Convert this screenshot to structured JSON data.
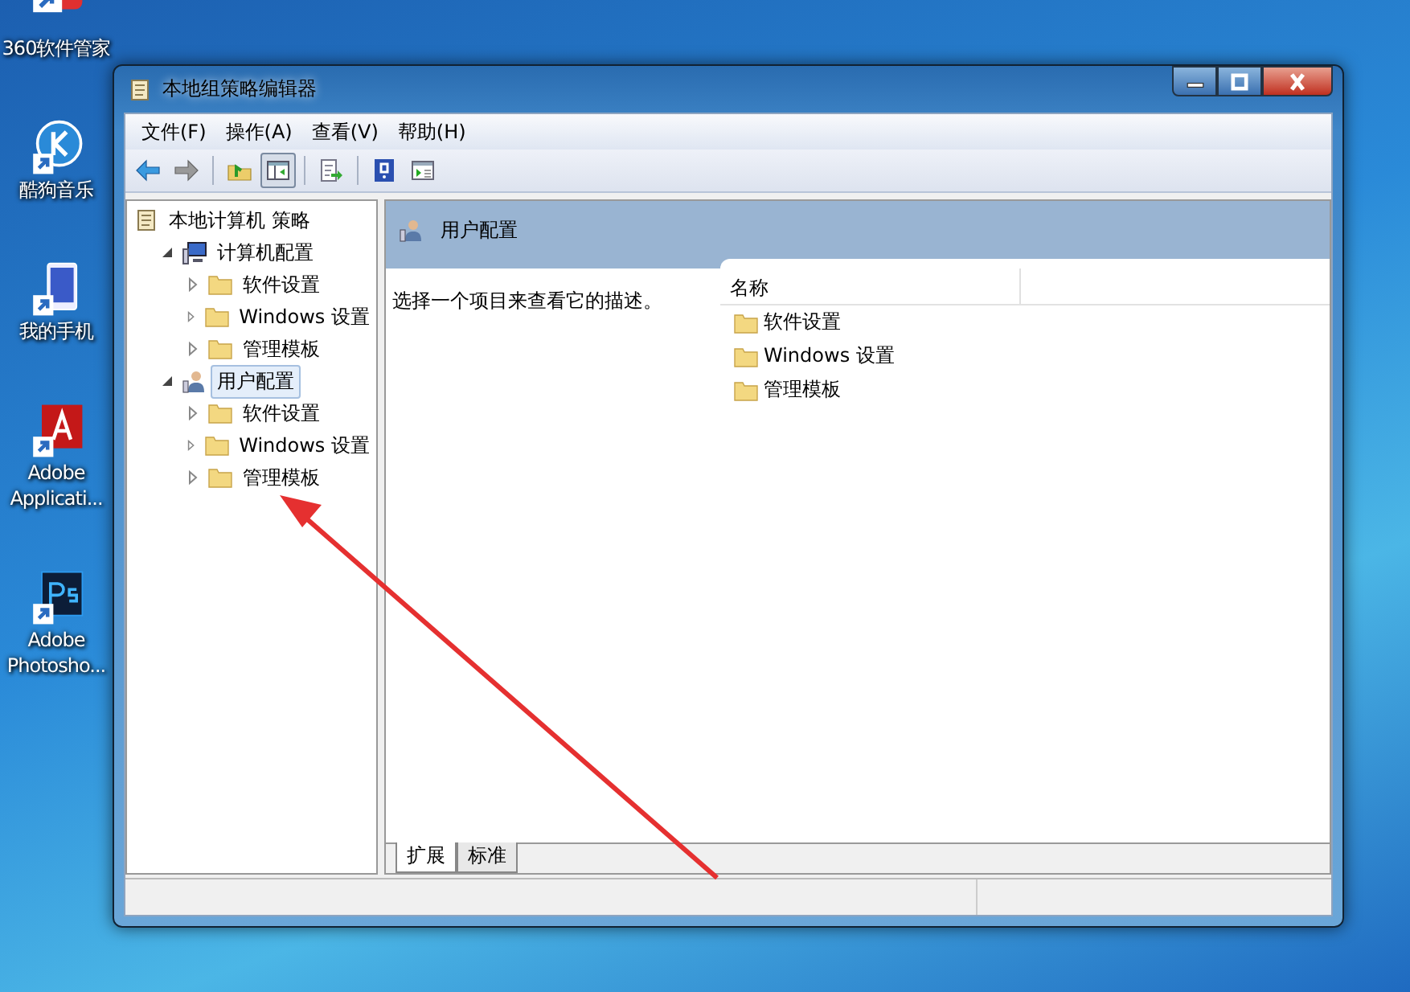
{
  "desktop_icons": [
    {
      "label": "360软件管家",
      "kind": "box"
    },
    {
      "label": "酷狗音乐",
      "kind": "k"
    },
    {
      "label": "我的手机",
      "kind": "phone"
    },
    {
      "label": "Adobe Applicati...",
      "kind": "adobe"
    },
    {
      "label": "Adobe Photosho...",
      "kind": "ps"
    }
  ],
  "window": {
    "title": "本地组策略编辑器"
  },
  "menu": [
    "文件(F)",
    "操作(A)",
    "查看(V)",
    "帮助(H)"
  ],
  "toolbar": [
    {
      "kind": "back"
    },
    {
      "kind": "forward"
    },
    {
      "kind": "sep"
    },
    {
      "kind": "up"
    },
    {
      "kind": "tree",
      "selected": true
    },
    {
      "kind": "sep"
    },
    {
      "kind": "export"
    },
    {
      "kind": "sep"
    },
    {
      "kind": "help"
    },
    {
      "kind": "console"
    }
  ],
  "tree": [
    {
      "label": "本地计算机 策略",
      "kind": "policy",
      "selected": false,
      "children": [
        {
          "label": "计算机配置",
          "kind": "computer",
          "expanded": true,
          "selected": false,
          "children": [
            {
              "label": "软件设置",
              "kind": "folder",
              "expanded": false,
              "selected": false
            },
            {
              "label": "Windows 设置",
              "kind": "folder",
              "expanded": false,
              "selected": false
            },
            {
              "label": "管理模板",
              "kind": "folder",
              "expanded": false,
              "selected": false
            }
          ]
        },
        {
          "label": "用户配置",
          "kind": "user",
          "expanded": true,
          "selected": true,
          "children": [
            {
              "label": "软件设置",
              "kind": "folder",
              "expanded": false,
              "selected": false
            },
            {
              "label": "Windows 设置",
              "kind": "folder",
              "expanded": false,
              "selected": false
            },
            {
              "label": "管理模板",
              "kind": "folder",
              "expanded": false,
              "selected": false
            }
          ]
        }
      ]
    }
  ],
  "detail": {
    "title": "用户配置",
    "description": "选择一个项目来查看它的描述。",
    "column": "名称",
    "items": [
      "软件设置",
      "Windows 设置",
      "管理模板"
    ]
  },
  "view_tabs": [
    {
      "label": "扩展",
      "selected": true
    },
    {
      "label": "标准",
      "selected": false
    }
  ]
}
